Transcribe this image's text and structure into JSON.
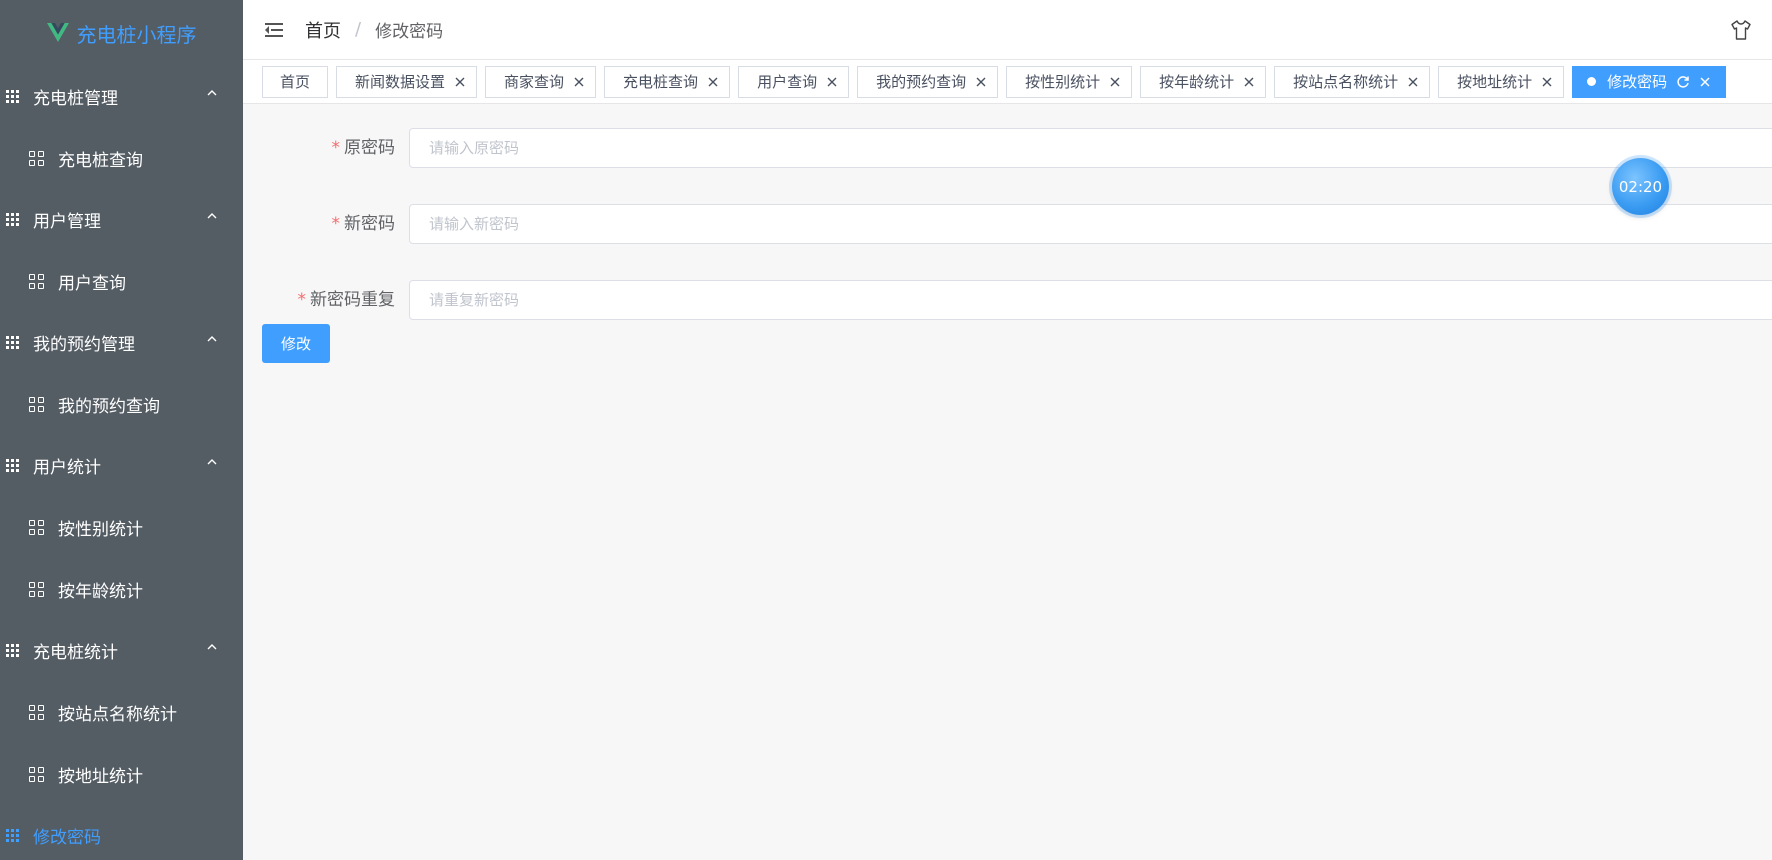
{
  "app": {
    "title": "充电桩小程序",
    "accent": "#409eff",
    "sidebar_bg": "#545c64"
  },
  "sidebar": {
    "groups": [
      {
        "label": "充电桩管理",
        "items": [
          "充电桩查询"
        ]
      },
      {
        "label": "用户管理",
        "items": [
          "用户查询"
        ]
      },
      {
        "label": "我的预约管理",
        "items": [
          "我的预约查询"
        ]
      },
      {
        "label": "用户统计",
        "items": [
          "按性别统计",
          "按年龄统计"
        ]
      },
      {
        "label": "充电桩统计",
        "items": [
          "按站点名称统计",
          "按地址统计"
        ]
      }
    ],
    "active_item": "修改密码"
  },
  "header": {
    "breadcrumb_home": "首页",
    "breadcrumb_sep": "/",
    "breadcrumb_current": "修改密码",
    "icons": [
      "menu-fold-icon",
      "theme-shirt-icon"
    ]
  },
  "tags": [
    {
      "label": "首页",
      "closable": false
    },
    {
      "label": "新闻数据设置",
      "closable": true
    },
    {
      "label": "商家查询",
      "closable": true
    },
    {
      "label": "充电桩查询",
      "closable": true
    },
    {
      "label": "用户查询",
      "closable": true
    },
    {
      "label": "我的预约查询",
      "closable": true
    },
    {
      "label": "按性别统计",
      "closable": true
    },
    {
      "label": "按年龄统计",
      "closable": true
    },
    {
      "label": "按站点名称统计",
      "closable": true
    },
    {
      "label": "按地址统计",
      "closable": true
    },
    {
      "label": "修改密码",
      "closable": true,
      "active": true
    }
  ],
  "form": {
    "required_mark": "*",
    "old_password": {
      "label": "原密码",
      "placeholder": "请输入原密码",
      "value": ""
    },
    "new_password": {
      "label": "新密码",
      "placeholder": "请输入新密码",
      "value": ""
    },
    "repeat_password": {
      "label": "新密码重复",
      "placeholder": "请重复新密码",
      "value": ""
    },
    "submit_label": "修改"
  },
  "timer": {
    "text": "02:20"
  }
}
